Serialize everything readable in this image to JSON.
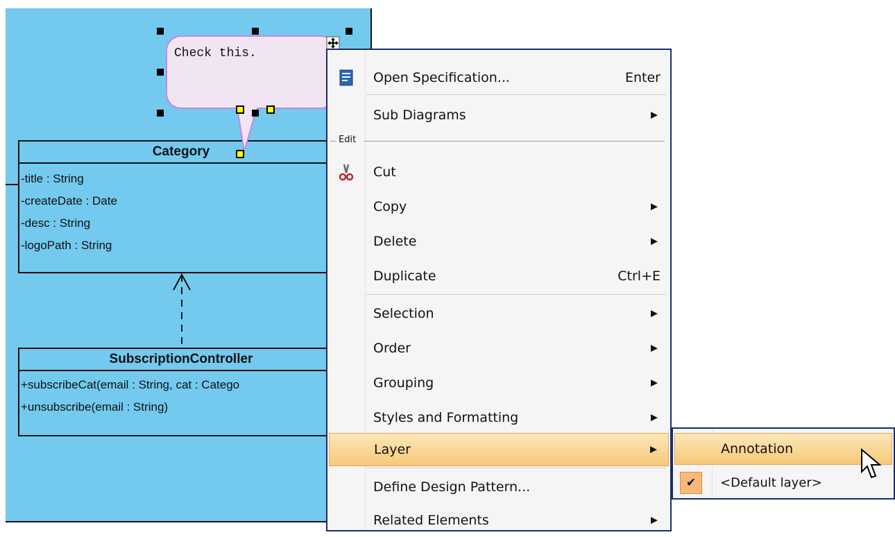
{
  "note": {
    "text": "Check this."
  },
  "classes": [
    {
      "name": "Category",
      "members": [
        "-title : String",
        "-createDate : Date",
        "-desc : String",
        "-logoPath : String"
      ]
    },
    {
      "name": "SubscriptionController",
      "members": [
        "+subscribeCat(email : String, cat : Catego",
        "+unsubscribe(email : String)"
      ]
    }
  ],
  "context_menu": {
    "items": [
      {
        "label": "Open Specification...",
        "shortcut": "Enter",
        "icon": "specification-icon"
      },
      {
        "label": "Sub Diagrams",
        "submenu": true
      },
      {
        "section": "Edit"
      },
      {
        "label": "Cut",
        "icon": "scissors-icon"
      },
      {
        "label": "Copy",
        "submenu": true
      },
      {
        "label": "Delete",
        "submenu": true
      },
      {
        "label": "Duplicate",
        "shortcut": "Ctrl+E"
      },
      {
        "label": "Selection",
        "submenu": true
      },
      {
        "label": "Order",
        "submenu": true
      },
      {
        "label": "Grouping",
        "submenu": true
      },
      {
        "label": "Styles and Formatting",
        "submenu": true
      },
      {
        "label": "Layer",
        "submenu": true,
        "highlighted": true
      },
      {
        "label": "Define Design Pattern..."
      },
      {
        "label": "Related Elements",
        "submenu": true
      }
    ]
  },
  "layer_submenu": {
    "items": [
      {
        "label": "Annotation",
        "highlighted": true
      },
      {
        "label": "<Default layer>",
        "checked": true
      }
    ]
  },
  "colors": {
    "canvas": "#73c9ee",
    "note_fill": "#f1e5f4",
    "menu_highlight": "#f6c97a"
  }
}
